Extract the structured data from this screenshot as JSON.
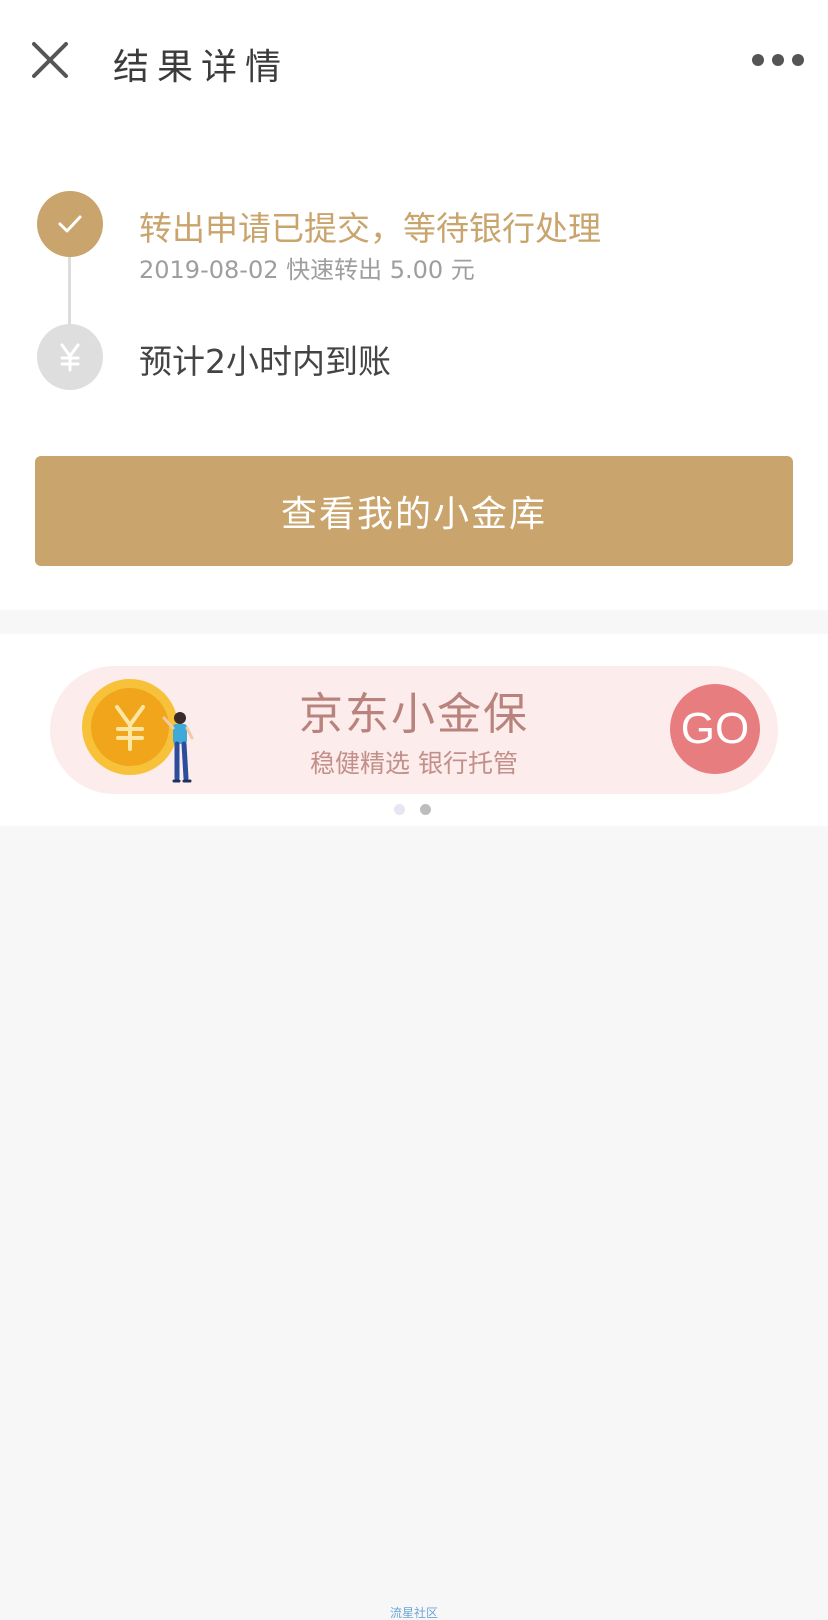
{
  "header": {
    "title": "结果详情",
    "close_icon": "close-icon",
    "more_icon": "more-dots-icon"
  },
  "timeline": {
    "step1": {
      "icon": "check-icon",
      "title": "转出申请已提交，等待银行处理",
      "subtitle": "2019-08-02 快速转出 5.00 元",
      "status": "done"
    },
    "step2": {
      "icon": "yen-icon",
      "title": "预计2小时内到账",
      "status": "pending"
    }
  },
  "primary_button": {
    "label": "查看我的小金库"
  },
  "banner": {
    "title": "京东小金保",
    "subtitle": "稳健精选 银行托管",
    "go_label": "GO",
    "coin_symbol": "¥",
    "carousel": {
      "count": 2,
      "active": 2
    }
  },
  "watermark": "流星社区",
  "colors": {
    "accent_gold": "#c9a46c",
    "banner_bg": "#fdecec",
    "go_red": "#e87d80"
  }
}
